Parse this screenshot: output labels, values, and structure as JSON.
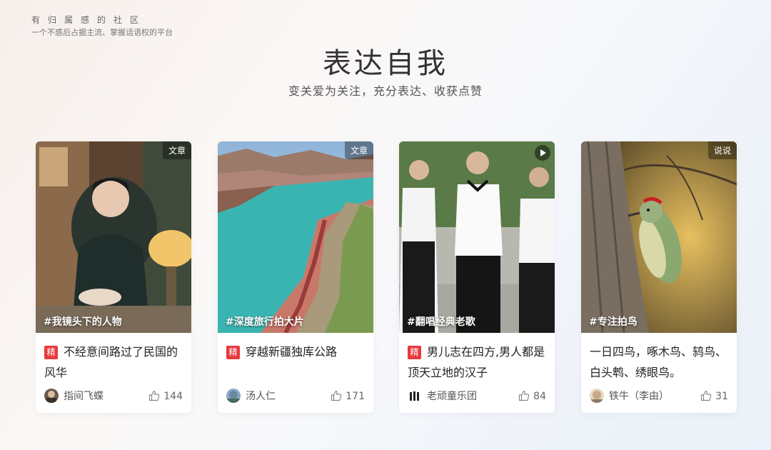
{
  "brand": {
    "line1": "有归属感的社区",
    "line2": "一个不惑后占据主流、掌握话语权的平台"
  },
  "hero": {
    "title": "表达自我",
    "subtitle": "变关爱为关注，充分表达、收获点赞"
  },
  "cards": [
    {
      "badge": "文章",
      "tag": "#我镜头下的人物",
      "featured": "精",
      "title": "不经意间路过了民国的风华",
      "author": "指间飞蝶",
      "likes": "144"
    },
    {
      "badge": "文章",
      "tag": "#深度旅行拍大片",
      "featured": "精",
      "title": "穿越新疆独库公路",
      "author": "汤人仁",
      "likes": "171"
    },
    {
      "badge": "",
      "tag": "#翻唱经典老歌",
      "featured": "精",
      "title": "男儿志在四方,男人都是顶天立地的汉子",
      "author": "老顽童乐团",
      "likes": "84"
    },
    {
      "badge": "说说",
      "tag": "#专注拍鸟",
      "featured": "",
      "title": "一日四鸟，啄木鸟、鸫鸟、白头鹎、绣眼鸟。",
      "author": "铁牛（李由）",
      "likes": "31"
    }
  ],
  "colors": {
    "featured_badge": "#e8393d"
  },
  "icons": {
    "like": "thumbs-up-icon",
    "video": "play-icon"
  }
}
